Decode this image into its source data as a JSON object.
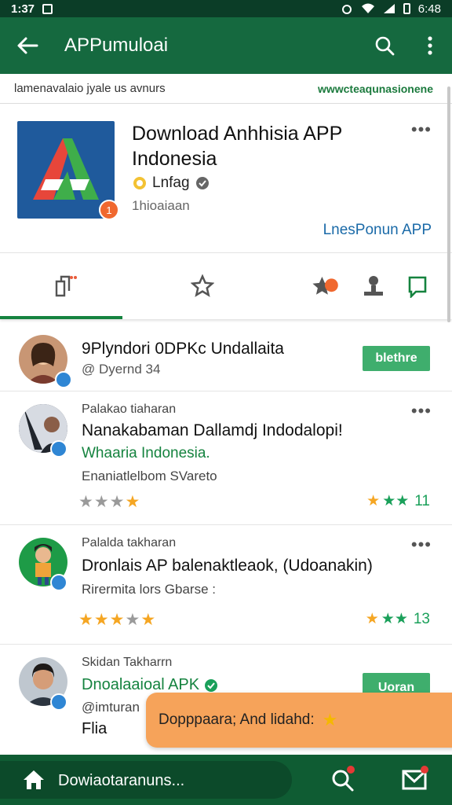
{
  "status_bar": {
    "time": "1:37",
    "battery_time": "6:48"
  },
  "app_bar": {
    "title": "APPumuloai"
  },
  "strip": {
    "left_text": "lamenavalaio jyale us avnurs",
    "right_text": "wwwcteaqunasionene"
  },
  "app": {
    "name": "Download Anhhisia APP Indonesia",
    "developer": "Lnfag",
    "subtitle": "1hioaiaan",
    "link": "LnesPonun APP",
    "badge": "1"
  },
  "tabs": [
    "details",
    "rating",
    "reviews",
    "download",
    "share"
  ],
  "reviews": [
    {
      "title": "9Plyndori 0DPKc Undallaita",
      "handle": "@ Dyernd 34",
      "button": "blethre"
    },
    {
      "meta": "Palakao tiaharan",
      "title": "Nanakabaman Dallamdj Indodalopi!",
      "subtitle": "Whaaria Indonesia.",
      "detail": "Enaniatlelbom SVareto",
      "rating": "11"
    },
    {
      "meta": "Palalda takharan",
      "title": "Dronlais AP balenaktleaok, (Udoanakin)",
      "detail": "Rirermita lors Gbarse :",
      "rating": "13"
    },
    {
      "meta": "Skidan Takharrn",
      "title": "Dnoalaaioal APK",
      "handle": "@imturan",
      "detail": "Flia",
      "button": "Uoran"
    }
  ],
  "toast": {
    "text": "Dopppaara; And lidahd:"
  },
  "bottom_nav": {
    "label": "Dowiaotaranuns..."
  },
  "colors": {
    "app_bar": "#15693f",
    "accent": "#15833f",
    "star": "#f5a623",
    "toast": "#f6a35a"
  }
}
